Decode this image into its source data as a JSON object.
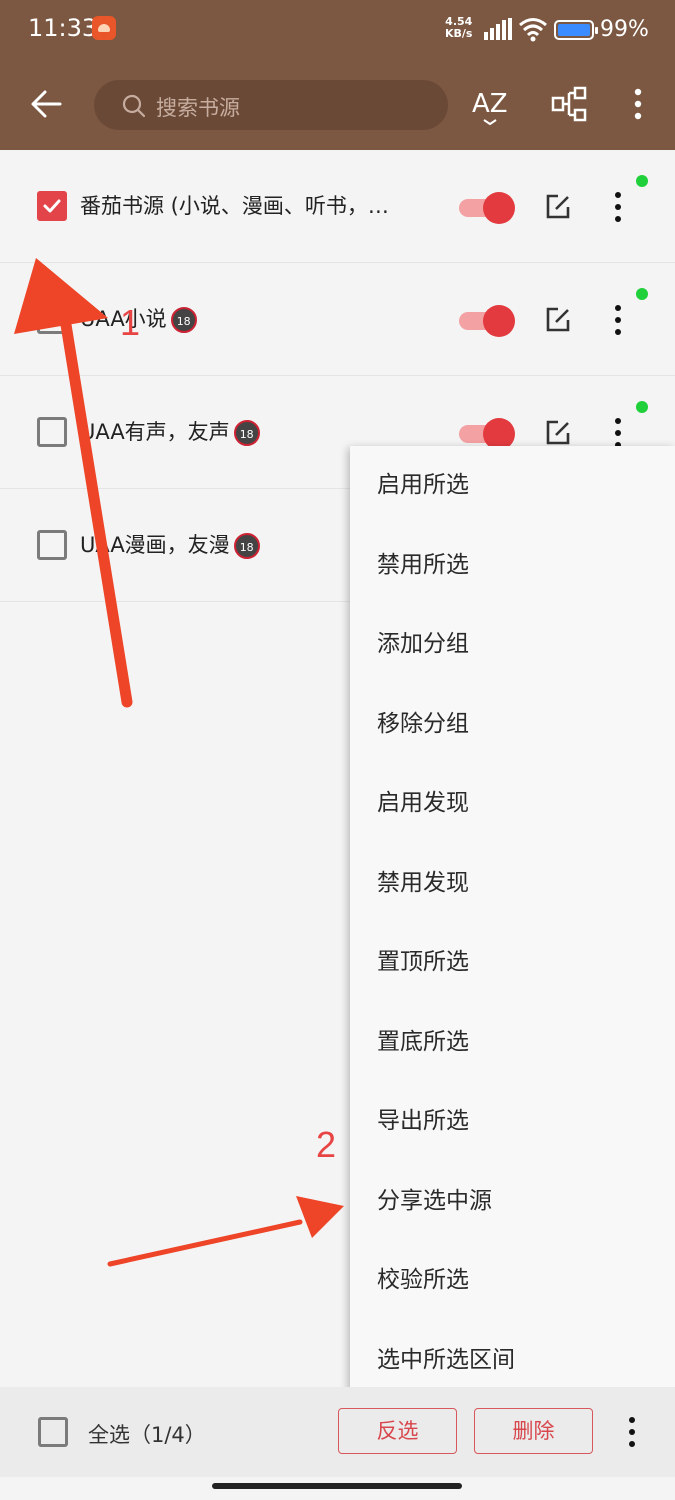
{
  "status_bar": {
    "time": "11:33",
    "net_speed": "4.54",
    "net_unit": "KB/s",
    "battery": "99%"
  },
  "toolbar": {
    "search_placeholder": "搜索书源",
    "az_label": "AZ"
  },
  "sources": [
    {
      "name": "番茄书源 (小说、漫画、听书，…",
      "checked": true,
      "enabled": true
    },
    {
      "name": "UAA小说",
      "checked": false,
      "enabled": true
    },
    {
      "name": "UAA有声，友声",
      "checked": false,
      "enabled": true
    },
    {
      "name": "UAA漫画，友漫",
      "checked": false,
      "enabled": true
    }
  ],
  "age_badge": "18",
  "menu": {
    "items": [
      "启用所选",
      "禁用所选",
      "添加分组",
      "移除分组",
      "启用发现",
      "禁用发现",
      "置顶所选",
      "置底所选",
      "导出所选",
      "分享选中源",
      "校验所选",
      "选中所选区间"
    ]
  },
  "bottom_bar": {
    "select_all": "全选（1/4）",
    "invert_button": "反选",
    "delete_button": "删除"
  },
  "annotations": {
    "label_1": "1",
    "label_2": "2",
    "color": "#e84444"
  }
}
